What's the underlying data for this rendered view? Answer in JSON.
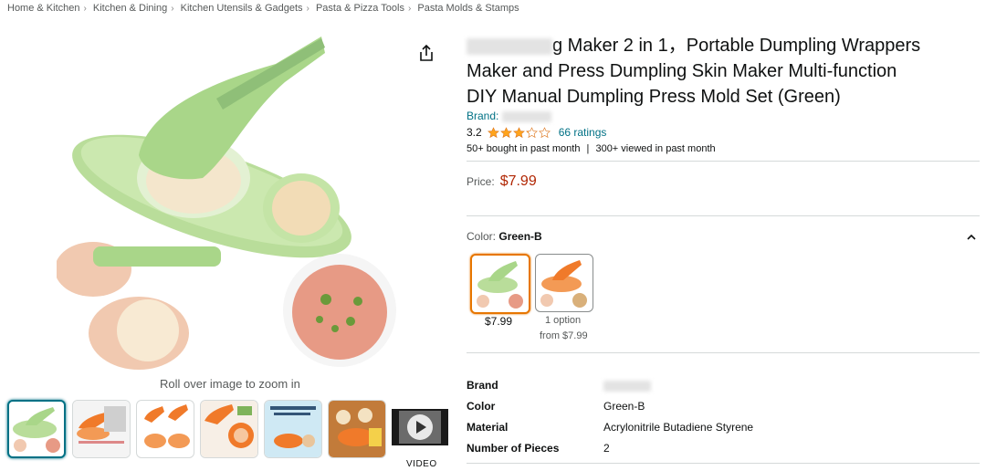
{
  "breadcrumb": [
    "Home & Kitchen",
    "Kitchen & Dining",
    "Kitchen Utensils & Gadgets",
    "Pasta & Pizza Tools",
    "Pasta Molds & Stamps"
  ],
  "title": {
    "line1_visible": "g Maker 2 in 1，Portable Dumpling Wrappers",
    "line2_visible": "Maker and Press Dumpling Skin Maker Multi-function",
    "line3_visible": "DIY Manual Dumpling Press Mold Set (Green)"
  },
  "brand_label": "Brand:",
  "rating": {
    "value": "3.2",
    "stars": 3.2,
    "count_label": "66 ratings"
  },
  "bought_text": "50+ bought in past month",
  "viewed_text": "300+ viewed in past month",
  "bought_sep": "|",
  "price": {
    "label": "Price:",
    "value": "$7.99"
  },
  "color": {
    "label": "Color:",
    "selected": "Green-B",
    "options": [
      {
        "price": "$7.99",
        "sub": ""
      },
      {
        "price": "1 option",
        "sub": "from $7.99"
      }
    ]
  },
  "gallery": {
    "zoom_hint": "Roll over image to zoom in",
    "video_label": "VIDEO"
  },
  "specs": [
    {
      "key": "Brand",
      "value": ""
    },
    {
      "key": "Color",
      "value": "Green-B"
    },
    {
      "key": "Material",
      "value": "Acrylonitrile Butadiene Styrene"
    },
    {
      "key": "Number of Pieces",
      "value": "2"
    }
  ],
  "colors": {
    "link": "#007185",
    "price": "#b12704",
    "star": "#ffa41c",
    "product_green": "#b9dd9a",
    "product_orange": "#f07a2a",
    "selected_border": "#e77600"
  },
  "icons": [
    "share-icon",
    "chevron-up-icon",
    "play-icon",
    "star-icon"
  ]
}
